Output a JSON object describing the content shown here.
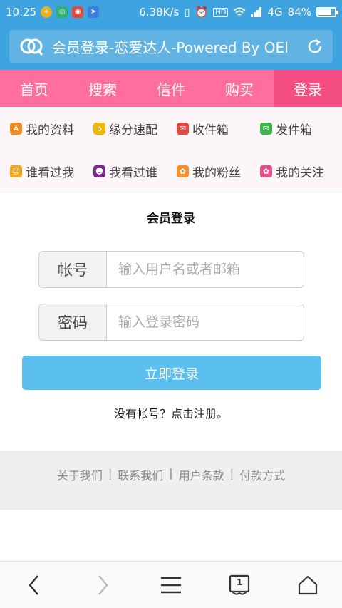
{
  "status": {
    "time": "10:25",
    "speed": "6.38K/s",
    "hd": "HD",
    "network": "4G",
    "battery": "84%",
    "battery_level": 0.84
  },
  "browser": {
    "url_title": "会员登录-恋爱达人-Powered By OEI",
    "tab_count": "1"
  },
  "nav": {
    "items": [
      {
        "label": "首页"
      },
      {
        "label": "搜索"
      },
      {
        "label": "信件"
      },
      {
        "label": "购买"
      },
      {
        "label": "登录"
      }
    ]
  },
  "quick": {
    "items": [
      {
        "label": "我的资料",
        "color": "#f08c1e"
      },
      {
        "label": "缘分速配",
        "color": "#f0b800"
      },
      {
        "label": "收件箱",
        "color": "#e5483c"
      },
      {
        "label": "发件箱",
        "color": "#3cb648"
      },
      {
        "label": "谁看过我",
        "color": "#f2a61b"
      },
      {
        "label": "我看过谁",
        "color": "#7a2a8c"
      },
      {
        "label": "我的粉丝",
        "color": "#f5902a"
      },
      {
        "label": "我的关注",
        "color": "#e84f8a"
      }
    ]
  },
  "login": {
    "title": "会员登录",
    "account_label": "帐号",
    "account_placeholder": "输入用户名或者邮箱",
    "password_label": "密码",
    "password_placeholder": "输入登录密码",
    "submit": "立即登录",
    "register": "没有帐号？点击注册。"
  },
  "footer": {
    "links": [
      "关于我们",
      "联系我们",
      "用户条款",
      "付款方式"
    ],
    "separator": "|"
  },
  "colors": {
    "header": "#3fa3df",
    "nav": "#ff6e9d",
    "nav_active": "#f34d82",
    "button": "#5bc0ef"
  }
}
